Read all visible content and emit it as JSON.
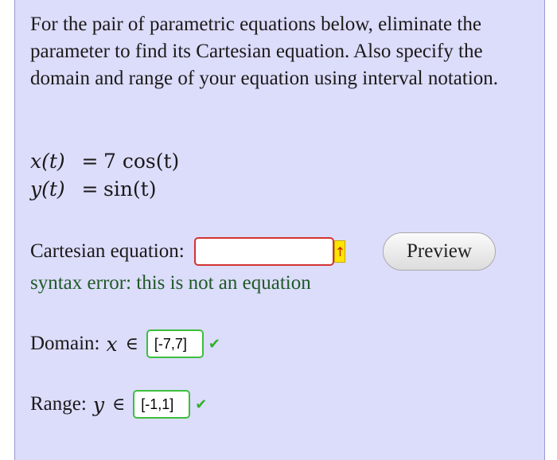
{
  "prompt_text": "For the pair of parametric equations below, eliminate the parameter to find its Cartesian equation. Also specify the domain and range of your equation using interval notation.",
  "equations": {
    "x": {
      "lhs": "x(t)",
      "eq": "=",
      "rhs": "7 cos(t)"
    },
    "y": {
      "lhs": "y(t)",
      "eq": "=",
      "rhs": "sin(t)"
    }
  },
  "cartesian": {
    "label": "Cartesian equation:",
    "value": "",
    "flag_icon": "arrow-up-icon",
    "error_color": "#d23333"
  },
  "preview_button": {
    "label": "Preview"
  },
  "feedback": {
    "text": "syntax error: this is not an equation",
    "color": "#1e5a25"
  },
  "domain": {
    "label": "Domain:",
    "variable": "x",
    "symbol": "∈",
    "value": "[-7,7]",
    "status_icon": "checkmark-icon"
  },
  "range": {
    "label": "Range:",
    "variable": "y",
    "symbol": "∈",
    "value": "[-1,1]",
    "status_icon": "checkmark-icon"
  },
  "colors": {
    "panel_bg": "#dcdcfb",
    "ok_border": "#3cbf3c"
  }
}
